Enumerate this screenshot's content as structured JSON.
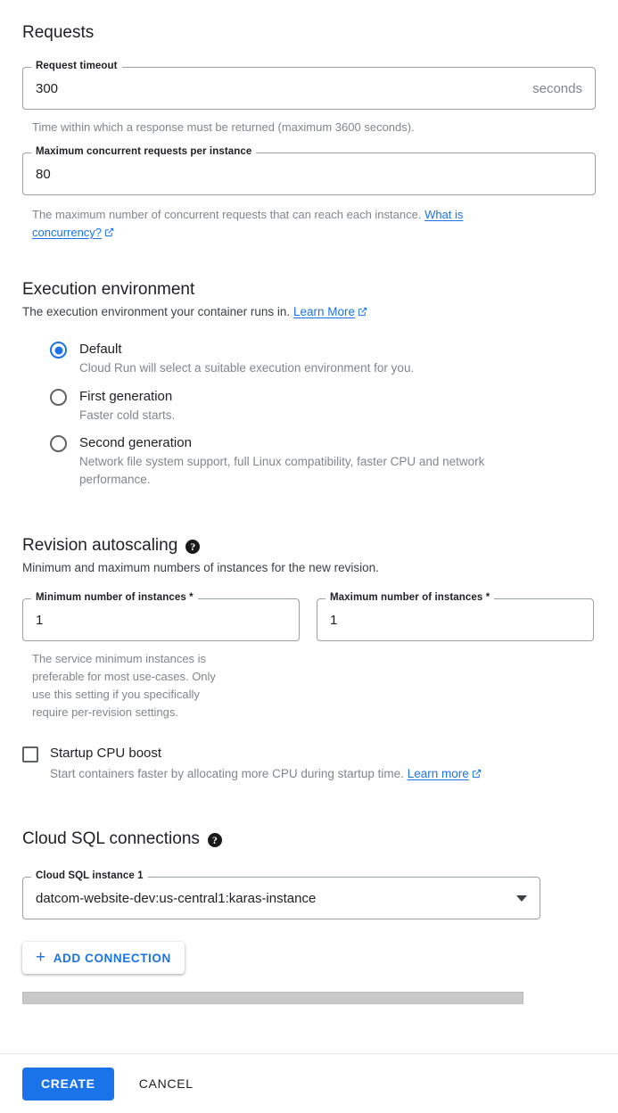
{
  "requests": {
    "title": "Requests",
    "timeout": {
      "label": "Request timeout",
      "value": "300",
      "suffix": "seconds",
      "helper": "Time within which a response must be returned (maximum 3600 seconds)."
    },
    "concurrency": {
      "label": "Maximum concurrent requests per instance",
      "value": "80",
      "helper_prefix": "The maximum number of concurrent requests that can reach each instance.",
      "helper_link": "What is concurrency?"
    }
  },
  "execution_environment": {
    "title": "Execution environment",
    "subtitle_prefix": "The execution environment your container runs in.",
    "subtitle_link": "Learn More",
    "options": [
      {
        "label": "Default",
        "desc": "Cloud Run will select a suitable execution environment for you.",
        "selected": true
      },
      {
        "label": "First generation",
        "desc": "Faster cold starts.",
        "selected": false
      },
      {
        "label": "Second generation",
        "desc": "Network file system support, full Linux compatibility, faster CPU and network performance.",
        "selected": false
      }
    ]
  },
  "revision_autoscaling": {
    "title": "Revision autoscaling",
    "help_icon": "help-icon",
    "subtitle": "Minimum and maximum numbers of instances for the new revision.",
    "min": {
      "label": "Minimum number of instances *",
      "value": "1",
      "helper": "The service minimum instances is preferable for most use-cases. Only use this setting if you specifically require per-revision settings."
    },
    "max": {
      "label": "Maximum number of instances *",
      "value": "1"
    },
    "cpu_boost": {
      "label": "Startup CPU boost",
      "checked": false,
      "desc_prefix": "Start containers faster by allocating more CPU during startup time.",
      "desc_link": "Learn more"
    }
  },
  "cloud_sql": {
    "title": "Cloud SQL connections",
    "help_icon": "help-icon",
    "instance": {
      "label": "Cloud SQL instance 1",
      "value": "datcom-website-dev:us-central1:karas-instance"
    },
    "add_connection_label": "ADD CONNECTION",
    "add_icon": "plus-icon"
  },
  "actions": {
    "create_label": "CREATE",
    "cancel_label": "CANCEL"
  },
  "colors": {
    "accent": "#1a73e8",
    "text": "#202124",
    "muted": "#80868b",
    "border": "#9aa0a6"
  }
}
